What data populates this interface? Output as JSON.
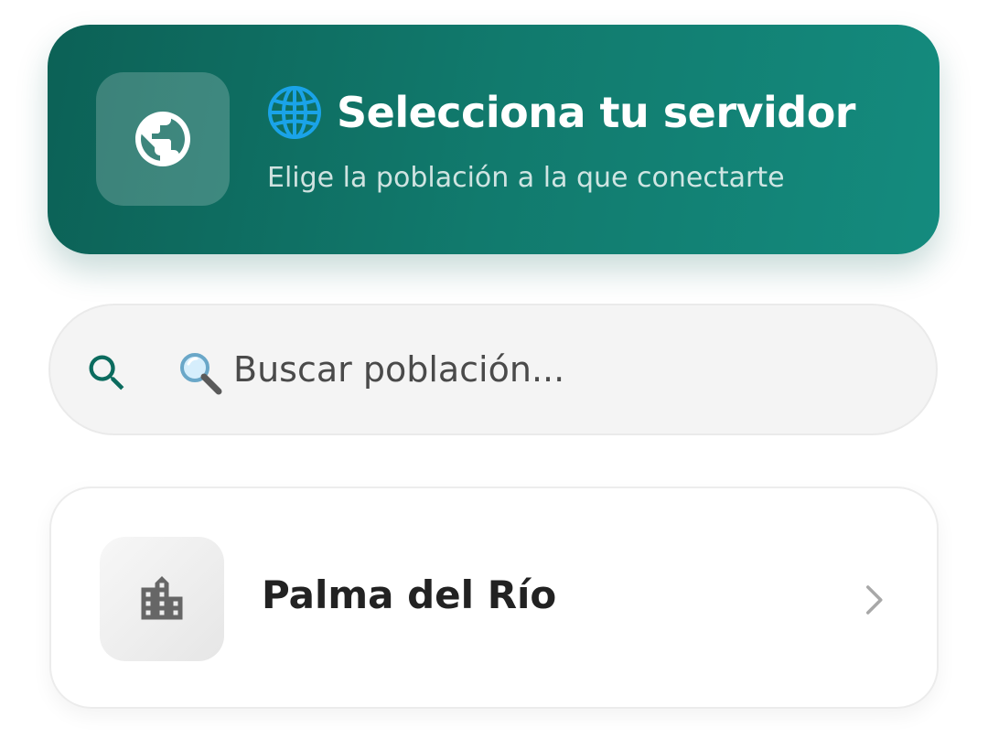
{
  "header": {
    "title_emoji": "🌐",
    "title": "Selecciona tu servidor",
    "subtitle": "Elige la población a la que conectarte",
    "icon": "globe-icon",
    "colors": {
      "gradient_start": "#0c6156",
      "gradient_end": "#148b7e"
    }
  },
  "search": {
    "icon": "search-icon",
    "placeholder": "Buscar población...",
    "value": "",
    "icon_color": "#0b6b5e"
  },
  "towns": [
    {
      "name": "Palma del Río",
      "icon": "city-icon",
      "action_icon": "chevron-right-icon"
    }
  ]
}
